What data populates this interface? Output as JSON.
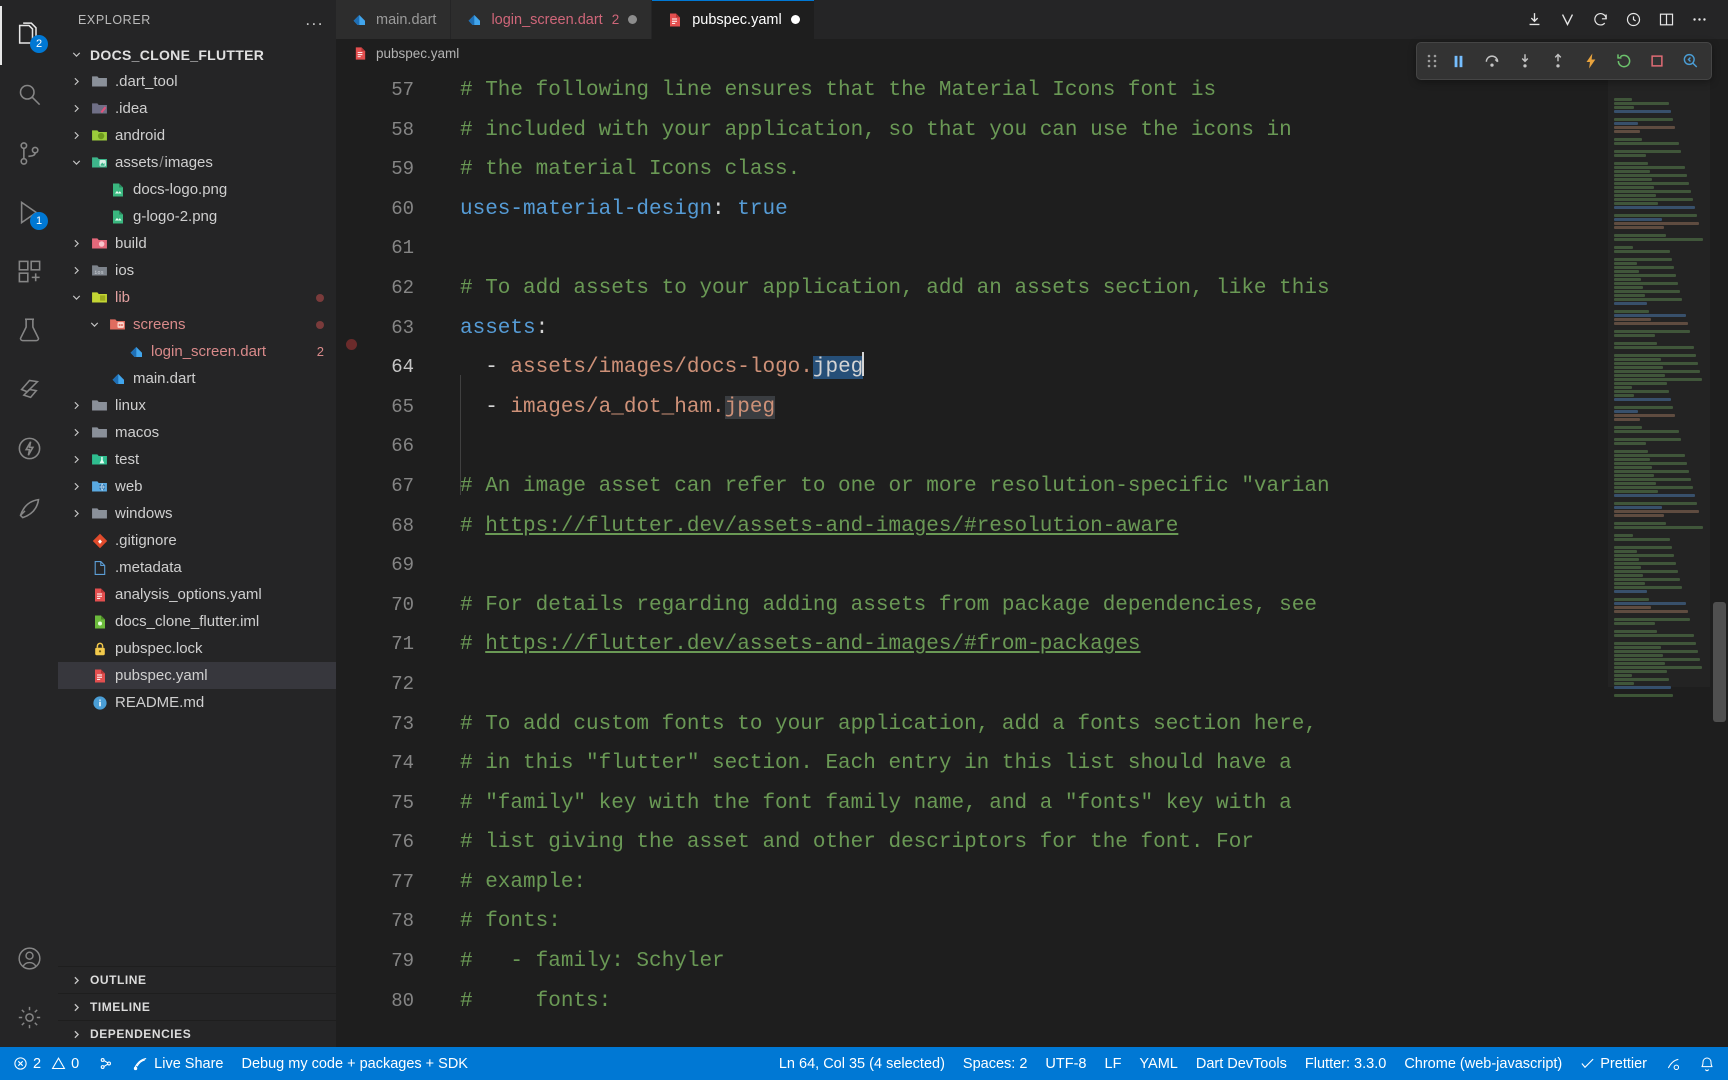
{
  "activitybar": {
    "items": [
      {
        "name": "explorer",
        "icon": "files-icon",
        "badge": "2",
        "active": true
      },
      {
        "name": "search",
        "icon": "search-icon",
        "badge": null,
        "active": false
      },
      {
        "name": "source-control",
        "icon": "source-control-icon",
        "badge": null,
        "active": false
      },
      {
        "name": "run-and-debug",
        "icon": "run-debug-icon",
        "badge": "1",
        "active": false
      },
      {
        "name": "extensions",
        "icon": "extensions-icon",
        "badge": null,
        "active": false
      },
      {
        "name": "testing",
        "icon": "beaker-icon",
        "badge": null,
        "active": false
      },
      {
        "name": "flutter",
        "icon": "flutter-icon",
        "badge": null,
        "active": false
      },
      {
        "name": "thunder-client",
        "icon": "thunder-icon",
        "badge": null,
        "active": false
      },
      {
        "name": "dart-devtools",
        "icon": "devtools-icon",
        "badge": null,
        "active": false
      }
    ],
    "bottom": [
      {
        "name": "accounts",
        "icon": "account-icon"
      },
      {
        "name": "manage",
        "icon": "gear-icon"
      }
    ]
  },
  "sidebar": {
    "title": "EXPLORER",
    "more_label": "...",
    "root": "DOCS_CLONE_FLUTTER",
    "tree": [
      {
        "label": ".dart_tool",
        "depth": 1,
        "type": "folder",
        "icon": "folder-grey",
        "expandable": true,
        "expanded": false
      },
      {
        "label": ".idea",
        "depth": 1,
        "type": "folder",
        "icon": "folder-idea",
        "expandable": true,
        "expanded": false
      },
      {
        "label": "android",
        "depth": 1,
        "type": "folder",
        "icon": "folder-android",
        "expandable": true,
        "expanded": false
      },
      {
        "label": "assets",
        "label2": "images",
        "depth": 1,
        "type": "folder",
        "icon": "folder-assets",
        "expandable": true,
        "expanded": true
      },
      {
        "label": "docs-logo.png",
        "depth": 2,
        "type": "file",
        "icon": "image-icon"
      },
      {
        "label": "g-logo-2.png",
        "depth": 2,
        "type": "file",
        "icon": "image-icon"
      },
      {
        "label": "build",
        "depth": 1,
        "type": "folder",
        "icon": "folder-build",
        "expandable": true,
        "expanded": false
      },
      {
        "label": "ios",
        "depth": 1,
        "type": "folder",
        "icon": "folder-ios",
        "expandable": true,
        "expanded": false
      },
      {
        "label": "lib",
        "depth": 1,
        "type": "folder",
        "icon": "folder-lib",
        "expandable": true,
        "expanded": true,
        "modified": true
      },
      {
        "label": "screens",
        "depth": 2,
        "type": "folder",
        "icon": "folder-screens",
        "expandable": true,
        "expanded": true,
        "modified": true,
        "error": true
      },
      {
        "label": "login_screen.dart",
        "depth": 3,
        "type": "file",
        "icon": "dart-icon",
        "error": true,
        "count": "2"
      },
      {
        "label": "main.dart",
        "depth": 2,
        "type": "file",
        "icon": "dart-icon"
      },
      {
        "label": "linux",
        "depth": 1,
        "type": "folder",
        "icon": "folder-grey",
        "expandable": true,
        "expanded": false
      },
      {
        "label": "macos",
        "depth": 1,
        "type": "folder",
        "icon": "folder-grey",
        "expandable": true,
        "expanded": false
      },
      {
        "label": "test",
        "depth": 1,
        "type": "folder",
        "icon": "folder-test",
        "expandable": true,
        "expanded": false
      },
      {
        "label": "web",
        "depth": 1,
        "type": "folder",
        "icon": "folder-web",
        "expandable": true,
        "expanded": false
      },
      {
        "label": "windows",
        "depth": 1,
        "type": "folder",
        "icon": "folder-grey",
        "expandable": true,
        "expanded": false
      },
      {
        "label": ".gitignore",
        "depth": 1,
        "type": "file",
        "icon": "git-icon"
      },
      {
        "label": ".metadata",
        "depth": 1,
        "type": "file",
        "icon": "file-icon"
      },
      {
        "label": "analysis_options.yaml",
        "depth": 1,
        "type": "file",
        "icon": "yaml-icon"
      },
      {
        "label": "docs_clone_flutter.iml",
        "depth": 1,
        "type": "file",
        "icon": "iml-icon"
      },
      {
        "label": "pubspec.lock",
        "depth": 1,
        "type": "file",
        "icon": "lock-icon"
      },
      {
        "label": "pubspec.yaml",
        "depth": 1,
        "type": "file",
        "icon": "yaml-icon",
        "selected": true
      },
      {
        "label": "README.md",
        "depth": 1,
        "type": "file",
        "icon": "info-icon"
      }
    ],
    "panels": [
      "OUTLINE",
      "TIMELINE",
      "DEPENDENCIES"
    ]
  },
  "tabs": [
    {
      "label": "main.dart",
      "icon": "dart-icon",
      "active": false,
      "count": null,
      "dirty": false,
      "modified": false
    },
    {
      "label": "login_screen.dart",
      "icon": "dart-icon",
      "active": false,
      "count": "2",
      "dirty": true,
      "modified": true
    },
    {
      "label": "pubspec.yaml",
      "icon": "yaml-icon",
      "active": true,
      "count": null,
      "dirty": true,
      "modified": false
    }
  ],
  "editor_actions": [
    {
      "name": "save-all-icon",
      "glyph": "⤓"
    },
    {
      "name": "version-control-icon",
      "glyph": "V"
    },
    {
      "name": "refresh-icon",
      "glyph": "⟳"
    },
    {
      "name": "history-icon",
      "glyph": "🕘"
    },
    {
      "name": "split-editor-icon",
      "glyph": "▥"
    },
    {
      "name": "more-actions-icon",
      "glyph": "···"
    }
  ],
  "breadcrumb": {
    "file": "pubspec.yaml",
    "icon": "yaml-icon"
  },
  "debug_toolbar": [
    {
      "name": "drag-handle-icon"
    },
    {
      "name": "pause-icon"
    },
    {
      "name": "step-over-icon"
    },
    {
      "name": "step-into-icon"
    },
    {
      "name": "step-out-icon"
    },
    {
      "name": "hot-reload-icon"
    },
    {
      "name": "hot-restart-icon"
    },
    {
      "name": "stop-icon"
    },
    {
      "name": "open-devtools-icon"
    }
  ],
  "editor": {
    "first_line": 57,
    "partial_top_line": "56",
    "partial_bottom_line": "81",
    "lines": [
      {
        "n": 57,
        "tokens": [
          {
            "t": "# The following line ensures that the Material Icons font is",
            "c": "cm"
          }
        ]
      },
      {
        "n": 58,
        "tokens": [
          {
            "t": "# included with your application, so that you can use the icons in",
            "c": "cm"
          }
        ]
      },
      {
        "n": 59,
        "tokens": [
          {
            "t": "# the material Icons class.",
            "c": "cm"
          }
        ]
      },
      {
        "n": 60,
        "tokens": [
          {
            "t": "uses-material-design",
            "c": "key"
          },
          {
            "t": ":",
            "c": "pun"
          },
          {
            "t": " true",
            "c": "val"
          }
        ]
      },
      {
        "n": 61,
        "tokens": []
      },
      {
        "n": 62,
        "tokens": [
          {
            "t": "# To add assets to your application, add an assets section, like this",
            "c": "cm"
          }
        ]
      },
      {
        "n": 63,
        "tokens": [
          {
            "t": "assets",
            "c": "key"
          },
          {
            "t": ":",
            "c": "pun"
          }
        ]
      },
      {
        "n": 64,
        "tokens": [
          {
            "t": "  - ",
            "c": "pun"
          },
          {
            "t": "assets/images/docs-logo.",
            "c": "str"
          },
          {
            "t": "jpeg",
            "c": "sel"
          }
        ],
        "current": true
      },
      {
        "n": 65,
        "tokens": [
          {
            "t": "  - ",
            "c": "pun"
          },
          {
            "t": "images/a_dot_ham.",
            "c": "str"
          },
          {
            "t": "jpeg",
            "c": "sel2"
          }
        ]
      },
      {
        "n": 66,
        "tokens": []
      },
      {
        "n": 67,
        "tokens": [
          {
            "t": "# An image asset can refer to one or more resolution-specific \"varian",
            "c": "cm"
          }
        ]
      },
      {
        "n": 68,
        "tokens": [
          {
            "t": "# ",
            "c": "cm"
          },
          {
            "t": "https://flutter.dev/assets-and-images/#resolution-aware",
            "c": "lnk"
          }
        ]
      },
      {
        "n": 69,
        "tokens": []
      },
      {
        "n": 70,
        "tokens": [
          {
            "t": "# For details regarding adding assets from package dependencies, see",
            "c": "cm"
          }
        ]
      },
      {
        "n": 71,
        "tokens": [
          {
            "t": "# ",
            "c": "cm"
          },
          {
            "t": "https://flutter.dev/assets-and-images/#from-packages",
            "c": "lnk"
          }
        ]
      },
      {
        "n": 72,
        "tokens": []
      },
      {
        "n": 73,
        "tokens": [
          {
            "t": "# To add custom fonts to your application, add a fonts section here,",
            "c": "cm"
          }
        ]
      },
      {
        "n": 74,
        "tokens": [
          {
            "t": "# in this \"flutter\" section. Each entry in this list should have a",
            "c": "cm"
          }
        ]
      },
      {
        "n": 75,
        "tokens": [
          {
            "t": "# \"family\" key with the font family name, and a \"fonts\" key with a",
            "c": "cm"
          }
        ]
      },
      {
        "n": 76,
        "tokens": [
          {
            "t": "# list giving the asset and other descriptors for the font. For",
            "c": "cm"
          }
        ]
      },
      {
        "n": 77,
        "tokens": [
          {
            "t": "# example:",
            "c": "cm"
          }
        ]
      },
      {
        "n": 78,
        "tokens": [
          {
            "t": "# fonts:",
            "c": "cm"
          }
        ]
      },
      {
        "n": 79,
        "tokens": [
          {
            "t": "#   - family: Schyler",
            "c": "cm"
          }
        ]
      },
      {
        "n": 80,
        "tokens": [
          {
            "t": "#     fonts:",
            "c": "cm"
          }
        ]
      }
    ]
  },
  "statusbar": {
    "left": [
      {
        "name": "problems",
        "icon": "error-icon",
        "errors": "2",
        "warn_icon": "warning-icon",
        "warnings": "0"
      },
      {
        "name": "remote",
        "icon": "remote-icon",
        "label": ""
      },
      {
        "name": "live-share",
        "icon": "live-share-icon",
        "label": "Live Share"
      },
      {
        "name": "debug-mode",
        "label": "Debug my code + packages + SDK"
      }
    ],
    "right": [
      {
        "name": "cursor-position",
        "label": "Ln 64, Col 35 (4 selected)"
      },
      {
        "name": "indentation",
        "label": "Spaces: 2"
      },
      {
        "name": "encoding",
        "label": "UTF-8"
      },
      {
        "name": "eol",
        "label": "LF"
      },
      {
        "name": "language-mode",
        "label": "YAML"
      },
      {
        "name": "dart-devtools",
        "label": "Dart DevTools"
      },
      {
        "name": "flutter-version",
        "label": "Flutter: 3.3.0"
      },
      {
        "name": "device",
        "label": "Chrome (web-javascript)"
      },
      {
        "name": "prettier",
        "label": "Prettier",
        "icon": "check-icon"
      },
      {
        "name": "broadcast",
        "icon": "broadcast-icon",
        "label": ""
      },
      {
        "name": "notifications",
        "icon": "bell-icon",
        "label": ""
      }
    ]
  },
  "colors": {
    "accent": "#0078d4",
    "editor_bg": "#1e1e1e",
    "sidebar_bg": "#252526",
    "comment": "#6A9955",
    "string": "#CE9178",
    "keyword": "#569CD6",
    "selection": "#264f78",
    "error": "#cf6679"
  }
}
